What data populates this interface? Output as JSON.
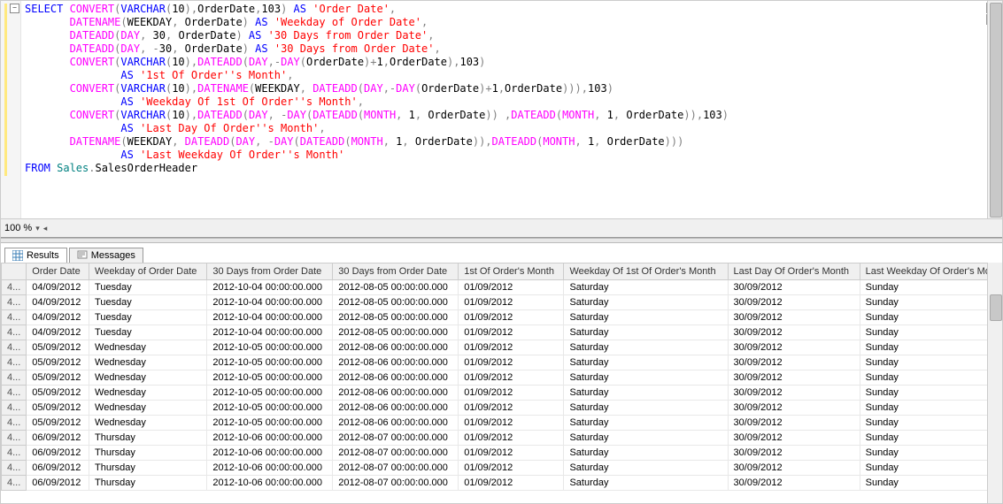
{
  "zoom": "100 %",
  "tabs": {
    "results": "Results",
    "messages": "Messages"
  },
  "sql_tokens": [
    [
      [
        "kw-blue",
        "SELECT "
      ],
      [
        "kw-pink",
        "CONVERT"
      ],
      [
        "kw-gray",
        "("
      ],
      [
        "kw-blue",
        "VARCHAR"
      ],
      [
        "kw-gray",
        "("
      ],
      [
        "",
        "10"
      ],
      [
        "kw-gray",
        ")"
      ],
      [
        "kw-gray",
        ","
      ],
      [
        "",
        "OrderDate"
      ],
      [
        "kw-gray",
        ","
      ],
      [
        "",
        "103"
      ],
      [
        "kw-gray",
        ") "
      ],
      [
        "kw-blue",
        "AS "
      ],
      [
        "kw-red",
        "'Order Date'"
      ],
      [
        "kw-gray",
        ","
      ]
    ],
    [
      [
        "",
        "       "
      ],
      [
        "kw-pink",
        "DATENAME"
      ],
      [
        "kw-gray",
        "("
      ],
      [
        "",
        "WEEKDAY"
      ],
      [
        "kw-gray",
        ", "
      ],
      [
        "",
        "OrderDate"
      ],
      [
        "kw-gray",
        ") "
      ],
      [
        "kw-blue",
        "AS "
      ],
      [
        "kw-red",
        "'Weekday of Order Date'"
      ],
      [
        "kw-gray",
        ","
      ]
    ],
    [
      [
        "",
        "       "
      ],
      [
        "kw-pink",
        "DATEADD"
      ],
      [
        "kw-gray",
        "("
      ],
      [
        "kw-pink",
        "DAY"
      ],
      [
        "kw-gray",
        ", "
      ],
      [
        "",
        "30"
      ],
      [
        "kw-gray",
        ", "
      ],
      [
        "",
        "OrderDate"
      ],
      [
        "kw-gray",
        ") "
      ],
      [
        "kw-blue",
        "AS "
      ],
      [
        "kw-red",
        "'30 Days from Order Date'"
      ],
      [
        "kw-gray",
        ","
      ]
    ],
    [
      [
        "",
        "       "
      ],
      [
        "kw-pink",
        "DATEADD"
      ],
      [
        "kw-gray",
        "("
      ],
      [
        "kw-pink",
        "DAY"
      ],
      [
        "kw-gray",
        ", "
      ],
      [
        "kw-gray",
        "-"
      ],
      [
        "",
        "30"
      ],
      [
        "kw-gray",
        ", "
      ],
      [
        "",
        "OrderDate"
      ],
      [
        "kw-gray",
        ") "
      ],
      [
        "kw-blue",
        "AS "
      ],
      [
        "kw-red",
        "'30 Days from Order Date'"
      ],
      [
        "kw-gray",
        ","
      ]
    ],
    [
      [
        "",
        "       "
      ],
      [
        "kw-pink",
        "CONVERT"
      ],
      [
        "kw-gray",
        "("
      ],
      [
        "kw-blue",
        "VARCHAR"
      ],
      [
        "kw-gray",
        "("
      ],
      [
        "",
        "10"
      ],
      [
        "kw-gray",
        ")"
      ],
      [
        "kw-gray",
        ","
      ],
      [
        "kw-pink",
        "DATEADD"
      ],
      [
        "kw-gray",
        "("
      ],
      [
        "kw-pink",
        "DAY"
      ],
      [
        "kw-gray",
        ","
      ],
      [
        "kw-gray",
        "-"
      ],
      [
        "kw-pink",
        "DAY"
      ],
      [
        "kw-gray",
        "("
      ],
      [
        "",
        "OrderDate"
      ],
      [
        "kw-gray",
        ")"
      ],
      [
        "kw-gray",
        "+"
      ],
      [
        "",
        "1"
      ],
      [
        "kw-gray",
        ","
      ],
      [
        "",
        "OrderDate"
      ],
      [
        "kw-gray",
        ")"
      ],
      [
        "kw-gray",
        ","
      ],
      [
        "",
        "103"
      ],
      [
        "kw-gray",
        ")"
      ]
    ],
    [
      [
        "",
        "               "
      ],
      [
        "kw-blue",
        "AS "
      ],
      [
        "kw-red",
        "'1st Of Order''s Month'"
      ],
      [
        "kw-gray",
        ","
      ]
    ],
    [
      [
        "",
        "       "
      ],
      [
        "kw-pink",
        "CONVERT"
      ],
      [
        "kw-gray",
        "("
      ],
      [
        "kw-blue",
        "VARCHAR"
      ],
      [
        "kw-gray",
        "("
      ],
      [
        "",
        "10"
      ],
      [
        "kw-gray",
        ")"
      ],
      [
        "kw-gray",
        ","
      ],
      [
        "kw-pink",
        "DATENAME"
      ],
      [
        "kw-gray",
        "("
      ],
      [
        "",
        "WEEKDAY"
      ],
      [
        "kw-gray",
        ", "
      ],
      [
        "kw-pink",
        "DATEADD"
      ],
      [
        "kw-gray",
        "("
      ],
      [
        "kw-pink",
        "DAY"
      ],
      [
        "kw-gray",
        ","
      ],
      [
        "kw-gray",
        "-"
      ],
      [
        "kw-pink",
        "DAY"
      ],
      [
        "kw-gray",
        "("
      ],
      [
        "",
        "OrderDate"
      ],
      [
        "kw-gray",
        ")"
      ],
      [
        "kw-gray",
        "+"
      ],
      [
        "",
        "1"
      ],
      [
        "kw-gray",
        ","
      ],
      [
        "",
        "OrderDate"
      ],
      [
        "kw-gray",
        ")))"
      ],
      [
        "kw-gray",
        ","
      ],
      [
        "",
        "103"
      ],
      [
        "kw-gray",
        ")"
      ]
    ],
    [
      [
        "",
        "               "
      ],
      [
        "kw-blue",
        "AS "
      ],
      [
        "kw-red",
        "'Weekday Of 1st Of Order''s Month'"
      ],
      [
        "kw-gray",
        ","
      ]
    ],
    [
      [
        "",
        "       "
      ],
      [
        "kw-pink",
        "CONVERT"
      ],
      [
        "kw-gray",
        "("
      ],
      [
        "kw-blue",
        "VARCHAR"
      ],
      [
        "kw-gray",
        "("
      ],
      [
        "",
        "10"
      ],
      [
        "kw-gray",
        ")"
      ],
      [
        "kw-gray",
        ","
      ],
      [
        "kw-pink",
        "DATEADD"
      ],
      [
        "kw-gray",
        "("
      ],
      [
        "kw-pink",
        "DAY"
      ],
      [
        "kw-gray",
        ", "
      ],
      [
        "kw-gray",
        "-"
      ],
      [
        "kw-pink",
        "DAY"
      ],
      [
        "kw-gray",
        "("
      ],
      [
        "kw-pink",
        "DATEADD"
      ],
      [
        "kw-gray",
        "("
      ],
      [
        "kw-pink",
        "MONTH"
      ],
      [
        "kw-gray",
        ", "
      ],
      [
        "",
        "1"
      ],
      [
        "kw-gray",
        ", "
      ],
      [
        "",
        "OrderDate"
      ],
      [
        "kw-gray",
        ")) "
      ],
      [
        "kw-gray",
        ","
      ],
      [
        "kw-pink",
        "DATEADD"
      ],
      [
        "kw-gray",
        "("
      ],
      [
        "kw-pink",
        "MONTH"
      ],
      [
        "kw-gray",
        ", "
      ],
      [
        "",
        "1"
      ],
      [
        "kw-gray",
        ", "
      ],
      [
        "",
        "OrderDate"
      ],
      [
        "kw-gray",
        "))"
      ],
      [
        "kw-gray",
        ","
      ],
      [
        "",
        "103"
      ],
      [
        "kw-gray",
        ")"
      ]
    ],
    [
      [
        "",
        "               "
      ],
      [
        "kw-blue",
        "AS "
      ],
      [
        "kw-red",
        "'Last Day Of Order''s Month'"
      ],
      [
        "kw-gray",
        ","
      ]
    ],
    [
      [
        "",
        "       "
      ],
      [
        "kw-pink",
        "DATENAME"
      ],
      [
        "kw-gray",
        "("
      ],
      [
        "",
        "WEEKDAY"
      ],
      [
        "kw-gray",
        ", "
      ],
      [
        "kw-pink",
        "DATEADD"
      ],
      [
        "kw-gray",
        "("
      ],
      [
        "kw-pink",
        "DAY"
      ],
      [
        "kw-gray",
        ", "
      ],
      [
        "kw-gray",
        "-"
      ],
      [
        "kw-pink",
        "DAY"
      ],
      [
        "kw-gray",
        "("
      ],
      [
        "kw-pink",
        "DATEADD"
      ],
      [
        "kw-gray",
        "("
      ],
      [
        "kw-pink",
        "MONTH"
      ],
      [
        "kw-gray",
        ", "
      ],
      [
        "",
        "1"
      ],
      [
        "kw-gray",
        ", "
      ],
      [
        "",
        "OrderDate"
      ],
      [
        "kw-gray",
        ")),"
      ],
      [
        "kw-pink",
        "DATEADD"
      ],
      [
        "kw-gray",
        "("
      ],
      [
        "kw-pink",
        "MONTH"
      ],
      [
        "kw-gray",
        ", "
      ],
      [
        "",
        "1"
      ],
      [
        "kw-gray",
        ", "
      ],
      [
        "",
        "OrderDate"
      ],
      [
        "kw-gray",
        ")))"
      ]
    ],
    [
      [
        "",
        "               "
      ],
      [
        "kw-blue",
        "AS "
      ],
      [
        "kw-red",
        "'Last Weekday Of Order''s Month'"
      ]
    ],
    [
      [
        "kw-blue",
        "FROM "
      ],
      [
        "kw-teal",
        "Sales"
      ],
      [
        "kw-gray",
        "."
      ],
      [
        "",
        "SalesOrderHeader"
      ]
    ]
  ],
  "grid": {
    "headers": [
      "",
      "Order Date",
      "Weekday of Order Date",
      "30 Days from Order Date",
      "30 Days from Order Date",
      "1st Of Order's Month",
      "Weekday Of 1st Of Order's Month",
      "Last Day Of Order's Month",
      "Last Weekday Of Order's Mo"
    ],
    "rows": [
      [
        "4...",
        "04/09/2012",
        "Tuesday",
        "2012-10-04 00:00:00.000",
        "2012-08-05 00:00:00.000",
        "01/09/2012",
        "Saturday",
        "30/09/2012",
        "Sunday"
      ],
      [
        "4...",
        "04/09/2012",
        "Tuesday",
        "2012-10-04 00:00:00.000",
        "2012-08-05 00:00:00.000",
        "01/09/2012",
        "Saturday",
        "30/09/2012",
        "Sunday"
      ],
      [
        "4...",
        "04/09/2012",
        "Tuesday",
        "2012-10-04 00:00:00.000",
        "2012-08-05 00:00:00.000",
        "01/09/2012",
        "Saturday",
        "30/09/2012",
        "Sunday"
      ],
      [
        "4...",
        "04/09/2012",
        "Tuesday",
        "2012-10-04 00:00:00.000",
        "2012-08-05 00:00:00.000",
        "01/09/2012",
        "Saturday",
        "30/09/2012",
        "Sunday"
      ],
      [
        "4...",
        "05/09/2012",
        "Wednesday",
        "2012-10-05 00:00:00.000",
        "2012-08-06 00:00:00.000",
        "01/09/2012",
        "Saturday",
        "30/09/2012",
        "Sunday"
      ],
      [
        "4...",
        "05/09/2012",
        "Wednesday",
        "2012-10-05 00:00:00.000",
        "2012-08-06 00:00:00.000",
        "01/09/2012",
        "Saturday",
        "30/09/2012",
        "Sunday"
      ],
      [
        "4...",
        "05/09/2012",
        "Wednesday",
        "2012-10-05 00:00:00.000",
        "2012-08-06 00:00:00.000",
        "01/09/2012",
        "Saturday",
        "30/09/2012",
        "Sunday"
      ],
      [
        "4...",
        "05/09/2012",
        "Wednesday",
        "2012-10-05 00:00:00.000",
        "2012-08-06 00:00:00.000",
        "01/09/2012",
        "Saturday",
        "30/09/2012",
        "Sunday"
      ],
      [
        "4...",
        "05/09/2012",
        "Wednesday",
        "2012-10-05 00:00:00.000",
        "2012-08-06 00:00:00.000",
        "01/09/2012",
        "Saturday",
        "30/09/2012",
        "Sunday"
      ],
      [
        "4...",
        "05/09/2012",
        "Wednesday",
        "2012-10-05 00:00:00.000",
        "2012-08-06 00:00:00.000",
        "01/09/2012",
        "Saturday",
        "30/09/2012",
        "Sunday"
      ],
      [
        "4...",
        "06/09/2012",
        "Thursday",
        "2012-10-06 00:00:00.000",
        "2012-08-07 00:00:00.000",
        "01/09/2012",
        "Saturday",
        "30/09/2012",
        "Sunday"
      ],
      [
        "4...",
        "06/09/2012",
        "Thursday",
        "2012-10-06 00:00:00.000",
        "2012-08-07 00:00:00.000",
        "01/09/2012",
        "Saturday",
        "30/09/2012",
        "Sunday"
      ],
      [
        "4...",
        "06/09/2012",
        "Thursday",
        "2012-10-06 00:00:00.000",
        "2012-08-07 00:00:00.000",
        "01/09/2012",
        "Saturday",
        "30/09/2012",
        "Sunday"
      ],
      [
        "4...",
        "06/09/2012",
        "Thursday",
        "2012-10-06 00:00:00.000",
        "2012-08-07 00:00:00.000",
        "01/09/2012",
        "Saturday",
        "30/09/2012",
        "Sunday"
      ]
    ]
  }
}
